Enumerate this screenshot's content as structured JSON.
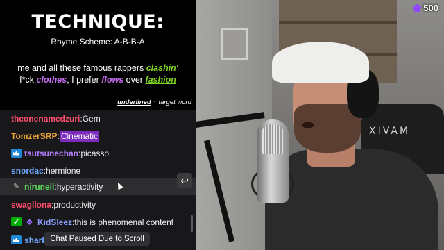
{
  "technique": {
    "title": "TECHNIQUE:",
    "subtitle": "Rhyme Scheme: A-B-B-A",
    "line1_pre": "me and all these famous rappers ",
    "line1_hl": "clashin'",
    "line2_pre": "f*ck ",
    "line2_hl1": "clothes",
    "line2_mid": ", I prefer ",
    "line2_hl2": "flows",
    "line2_mid2": " over ",
    "line2_hl3": "fashion",
    "legend_bold": "underlined",
    "legend_rest": " = target word"
  },
  "chat": {
    "messages": [
      {
        "user": "theonenamedzuri",
        "text": "Gem",
        "color": "#ff4f6d"
      },
      {
        "user": "TomzerSRP",
        "text": "Cinematic",
        "color": "#e8a33a"
      },
      {
        "user": "tsutsunechan",
        "text": "picasso",
        "color": "#b47cff"
      },
      {
        "user": "snordac",
        "text": "hermione",
        "color": "#6fa8ff"
      },
      {
        "user": "niruneil",
        "text": "hyperactivity",
        "color": "#5ad35a"
      },
      {
        "user": "swagllona",
        "text": "productivity",
        "color": "#ff4f6d"
      },
      {
        "user": "KidSleez",
        "text": "this is phenomenal content",
        "color": "#8a9cff"
      },
      {
        "user": "sharks",
        "text": "",
        "color": "#6fa8ff"
      }
    ],
    "paused_label": "Chat Paused Due to Scroll"
  },
  "stream": {
    "chair_brand": "XIVAM",
    "sub_count": "500"
  },
  "colors": {
    "accent_green": "#7ed321",
    "accent_purple": "#c86ef2",
    "twitch_purple": "#9147ff"
  }
}
